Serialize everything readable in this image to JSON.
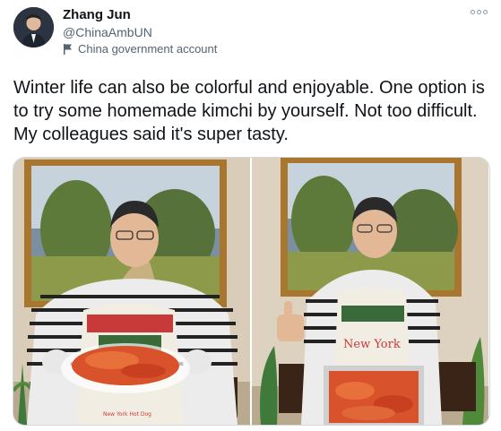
{
  "author": {
    "name": "Zhang Jun",
    "handle": "@ChinaAmbUN",
    "account_label": "China government account"
  },
  "tweet": {
    "text": "Winter life can also be colorful and enjoyable. One option is to try some homemade kimchi by yourself. Not too difficult. My colleagues said it's super tasty."
  },
  "icons": {
    "more": "more-options-icon",
    "flag": "flag-icon"
  },
  "media": {
    "count": 2,
    "photo_1": {
      "apron_text": "New York Hot Dog"
    },
    "photo_2": {
      "apron_text": "New York"
    }
  },
  "colors": {
    "text": "#0f1419",
    "secondary": "#536471",
    "border": "#cfd9de"
  }
}
